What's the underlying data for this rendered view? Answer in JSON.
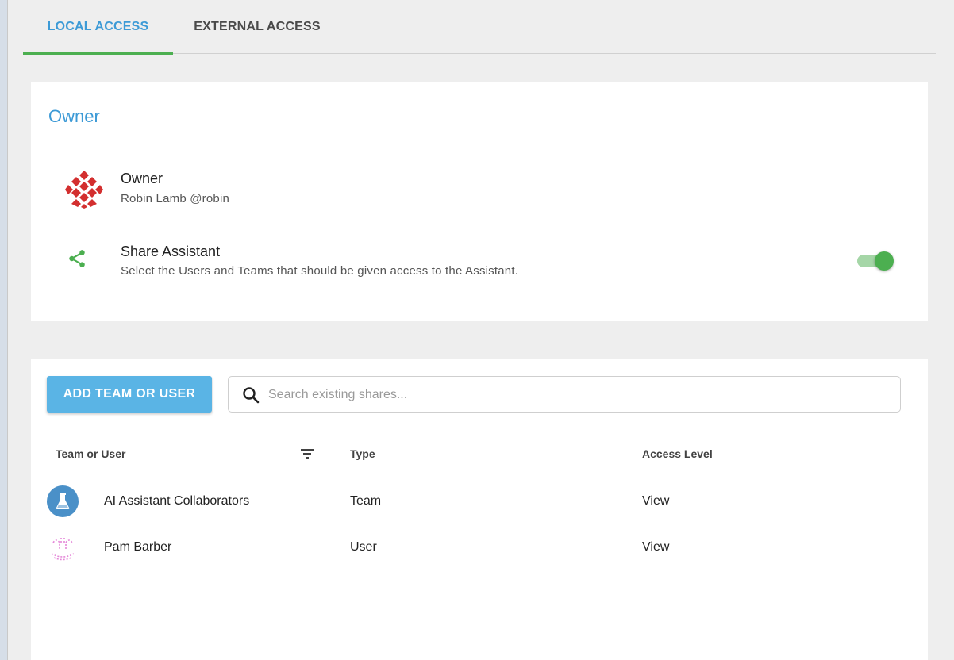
{
  "tabs": [
    {
      "label": "LOCAL ACCESS",
      "active": true
    },
    {
      "label": "EXTERNAL ACCESS",
      "active": false
    }
  ],
  "owner_section": {
    "title": "Owner",
    "owner_row": {
      "title": "Owner",
      "subtitle": "Robin Lamb @robin"
    },
    "share_row": {
      "title": "Share Assistant",
      "subtitle": "Select the Users and Teams that should be given access to the Assistant.",
      "toggle_on": true
    }
  },
  "shares": {
    "add_button_label": "ADD TEAM OR USER",
    "search_placeholder": "Search existing shares...",
    "search_value": "",
    "columns": [
      "Team or User",
      "Type",
      "Access Level"
    ],
    "rows": [
      {
        "name": "AI Assistant Collaborators",
        "type": "Team",
        "access": "View",
        "avatar_icon": "flask-icon"
      },
      {
        "name": "Pam Barber",
        "type": "User",
        "access": "View",
        "avatar_icon": "user-avatar"
      }
    ]
  },
  "colors": {
    "accent_blue": "#3c9ad6",
    "accent_green": "#4caf50",
    "button_blue": "#5ab4e5"
  }
}
